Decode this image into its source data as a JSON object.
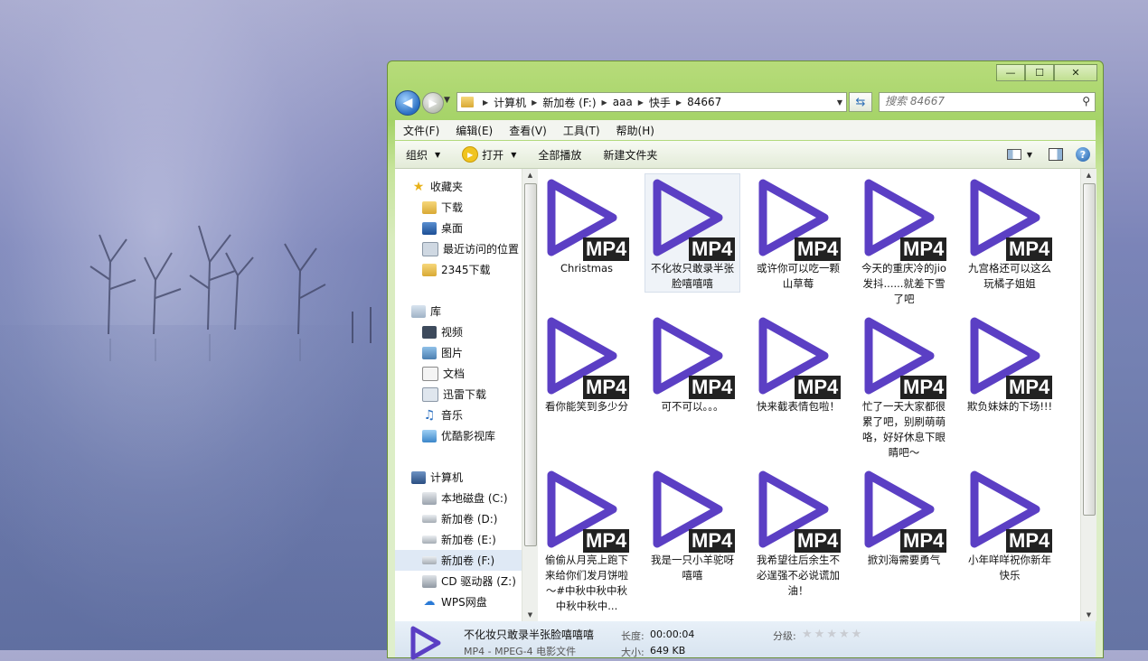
{
  "window": {
    "controls": {
      "minimize": "—",
      "maximize": "☐",
      "close": "✕"
    }
  },
  "address": {
    "crumbs": [
      "计算机",
      "新加卷 (F:)",
      "aaa",
      "快手",
      "84667"
    ],
    "search_placeholder": "搜索 84667"
  },
  "menu": [
    "文件(F)",
    "编辑(E)",
    "查看(V)",
    "工具(T)",
    "帮助(H)"
  ],
  "toolbar": {
    "organize": "组织",
    "open": "打开",
    "play_all": "全部播放",
    "new_folder": "新建文件夹"
  },
  "nav": {
    "favorites": {
      "label": "收藏夹",
      "items": [
        "下载",
        "桌面",
        "最近访问的位置",
        "2345下载"
      ]
    },
    "libraries": {
      "label": "库",
      "items": [
        "视频",
        "图片",
        "文档",
        "迅雷下载",
        "音乐",
        "优酷影视库"
      ]
    },
    "computer": {
      "label": "计算机",
      "items": [
        "本地磁盘 (C:)",
        "新加卷 (D:)",
        "新加卷 (E:)",
        "新加卷 (F:)",
        "CD 驱动器 (Z:)",
        "WPS网盘"
      ]
    }
  },
  "files": {
    "badge": "MP4",
    "row1": [
      "Christmas",
      "不化妆只敢录半张脸嘻嘻嘻",
      "或许你可以吃一颗山草莓",
      "今天的重庆冷的jio发抖......就差下雪了吧",
      "九宫格还可以这么玩橘子姐姐"
    ],
    "row2": [
      "看你能笑到多少分",
      "可不可以。。。",
      "快来截表情包啦！",
      "忙了一天大家都很累了吧，别刷萌萌咯，好好休息下眼睛吧～",
      "欺负妹妹的下场!!!"
    ],
    "row3": [
      "偷偷从月亮上跑下来给你们发月饼啦～#中秋中秋中秋中秋中秋中...",
      "我是一只小羊驼呀嘻嘻",
      "我希望往后余生不必逞强不必说谎加油！",
      "掀刘海需要勇气",
      "小年咩咩祝你新年快乐"
    ]
  },
  "details": {
    "name": "不化妆只敢录半张脸嘻嘻嘻",
    "type": "MP4 - MPEG-4 电影文件",
    "length_label": "长度:",
    "length_value": "00:00:04",
    "size_label": "大小:",
    "size_value": "649 KB",
    "rating_label": "分级:",
    "rating": 0
  },
  "colors": {
    "play_icon": "#5b3fc4",
    "badge_bg": "#222222",
    "window_frame": "#a5d368"
  }
}
